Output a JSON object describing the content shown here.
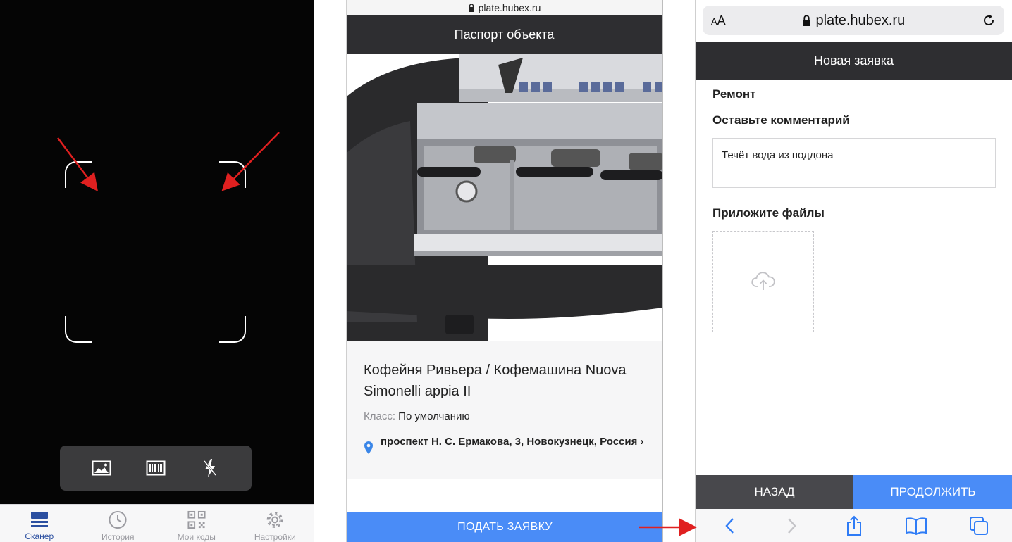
{
  "scanner": {
    "toolbar": {
      "gallery_icon": "image-icon",
      "barcode_icon": "barcode-icon",
      "flash_icon": "flash-off-icon"
    },
    "tabs": [
      {
        "label": "Сканер",
        "icon": "scanner-icon",
        "active": true
      },
      {
        "label": "История",
        "icon": "clock-icon",
        "active": false
      },
      {
        "label": "Мои коды",
        "icon": "qr-code-icon",
        "active": false
      },
      {
        "label": "Настройки",
        "icon": "gear-icon",
        "active": false
      }
    ]
  },
  "passport": {
    "url": "plate.hubex.ru",
    "header_title": "Паспорт объекта",
    "object_title": "Кофейня Ривьера / Кофемашина Nuova Simonelli appia II",
    "class_label": "Класс:",
    "class_value": "По умолчанию",
    "address": "проспект Н. С. Ермакова, 3, Новокузнецк, Россия",
    "address_chevron": "›",
    "submit_label": "ПОДАТЬ ЗАЯВКУ"
  },
  "request": {
    "aa_label": "AA",
    "url": "plate.hubex.ru",
    "header_title": "Новая заявка",
    "category": "Ремонт",
    "comment_label": "Оставьте комментарий",
    "comment_value": "Течёт вода из поддона",
    "files_label": "Приложите файлы",
    "back_label": "НАЗАД",
    "continue_label": "ПРОДОЛЖИТЬ"
  },
  "colors": {
    "accent_blue": "#4a8cf7",
    "header_dark": "#2e2e31",
    "arrow_red": "#e02020",
    "tab_active": "#2b4fa0"
  }
}
